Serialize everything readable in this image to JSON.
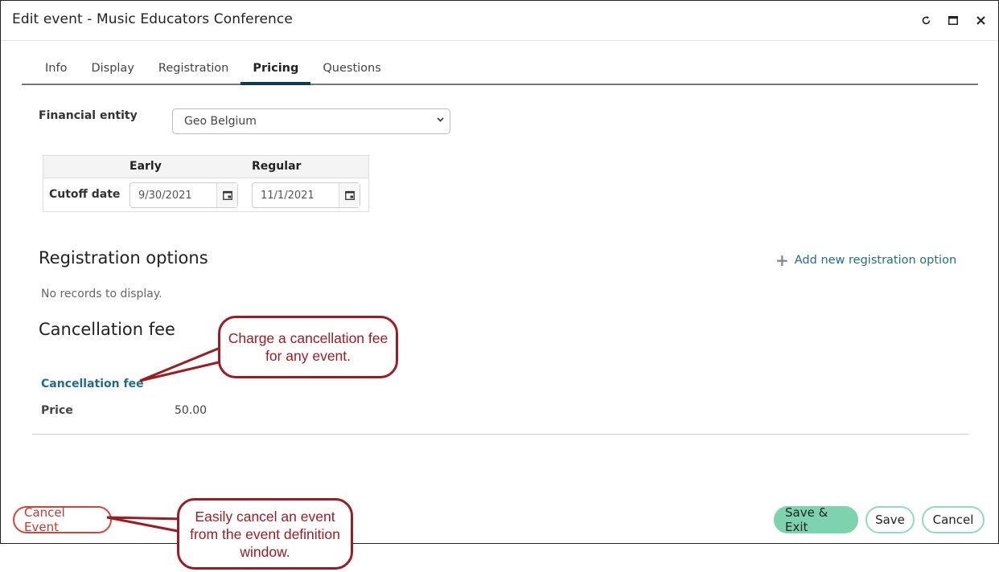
{
  "window": {
    "title": "Edit event - Music Educators Conference",
    "controls": [
      {
        "name": "refresh-icon",
        "glyph": "↻"
      },
      {
        "name": "maximize-icon",
        "glyph": "▭"
      },
      {
        "name": "close-icon",
        "glyph": "✕"
      }
    ]
  },
  "tabs": [
    {
      "label": "Info",
      "active": false
    },
    {
      "label": "Display",
      "active": false
    },
    {
      "label": "Registration",
      "active": false
    },
    {
      "label": "Pricing",
      "active": true
    },
    {
      "label": "Questions",
      "active": false
    }
  ],
  "pricing": {
    "financial_entity_label": "Financial entity",
    "financial_entity_value": "Geo Belgium",
    "date_table": {
      "col_early": "Early",
      "col_regular": "Regular",
      "row_label": "Cutoff date",
      "early_date": "9/30/2021",
      "regular_date": "11/1/2021"
    },
    "registration_options": {
      "heading": "Registration options",
      "add_link": "Add new registration option",
      "empty_text": "No records to display."
    },
    "cancellation_fee": {
      "heading": "Cancellation fee",
      "link": "Cancellation fee",
      "price_label": "Price",
      "price_value": "50.00"
    }
  },
  "footer": {
    "cancel_event": "Cancel Event",
    "save_exit": "Save & Exit",
    "save": "Save",
    "cancel": "Cancel"
  },
  "callouts": {
    "cancellation": "Charge a cancellation fee for any event.",
    "cancel_event": "Easily cancel an event from the event definition window."
  },
  "colors": {
    "accent_tab": "#0d3e4f",
    "link": "#1f6d8a",
    "primary_button": "#7dd3ae",
    "danger": "#d9423a",
    "callout": "#9b1c22"
  }
}
